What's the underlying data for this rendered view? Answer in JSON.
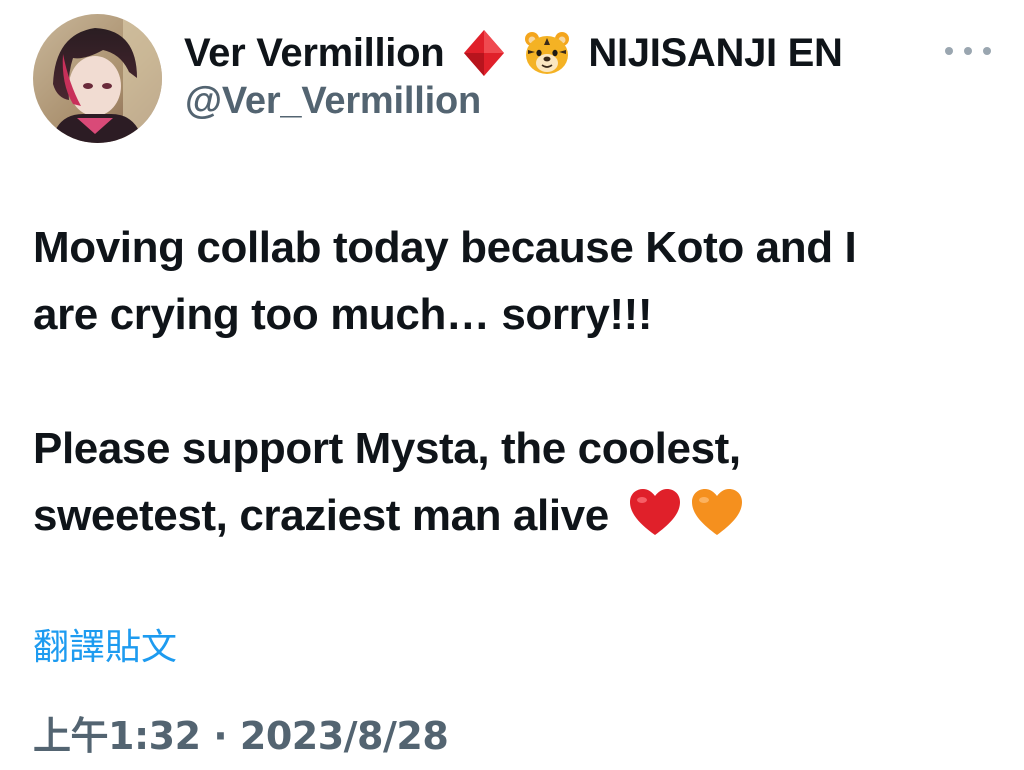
{
  "author": {
    "display_name": "Ver Vermillion",
    "group_name": "NIJISANJI EN",
    "handle": "@Ver_Vermillion",
    "avatar_icon": "avatar-image",
    "badge_icons": [
      "diamond-icon",
      "tiger-face-icon"
    ]
  },
  "tweet": {
    "line1": "Moving collab today because Koto and I",
    "line2": "are crying too much… sorry!!!",
    "line3": "Please support Mysta, the coolest,",
    "line4": "sweetest, craziest man alive",
    "hearts": [
      "red-heart-icon",
      "orange-heart-icon"
    ]
  },
  "translate_label": "翻譯貼文",
  "timestamp": "上午1:32 · 2023/8/28",
  "more_icon": "more-options-icon",
  "colors": {
    "text": "#0f1419",
    "secondary": "#536471",
    "link": "#1d9bf0",
    "red_heart": "#e0202a",
    "orange_heart": "#f5901e"
  }
}
